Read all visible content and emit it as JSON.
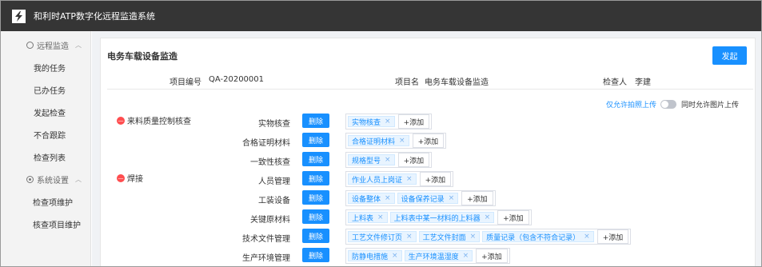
{
  "app": {
    "title": "和利时ATP数字化远程监造系统"
  },
  "sidebar": {
    "groups": [
      {
        "label": "远程监造",
        "items": [
          "我的任务",
          "已办任务",
          "发起检查",
          "不合跟踪",
          "检查列表"
        ]
      },
      {
        "label": "系统设置",
        "items": [
          "检查项维护",
          "核查项目维护"
        ]
      }
    ]
  },
  "page": {
    "title": "电务车载设备监造",
    "submit_label": "发起",
    "info": {
      "project_no_label": "项目编号",
      "project_no": "QA-20200001",
      "project_name_label": "项目名",
      "project_name": "电务车载设备监造",
      "inspector_label": "检查人",
      "inspector": "李建"
    },
    "toggle": {
      "left_label": "仅允许拍照上传",
      "right_label": "同时允许图片上传",
      "on": false
    },
    "categories": [
      {
        "name": "来料质量控制核查"
      },
      {
        "name": "焊接"
      }
    ],
    "rows": [
      {
        "label": "实物核查",
        "tags": [
          "实物核查"
        ]
      },
      {
        "label": "合格证明材料",
        "tags": [
          "合格证明材料"
        ]
      },
      {
        "label": "一致性核查",
        "tags": [
          "规格型号"
        ]
      },
      {
        "label": "人员管理",
        "tags": [
          "作业人员上岗证"
        ]
      },
      {
        "label": "工装设备",
        "tags": [
          "设备整体",
          "设备保养记录"
        ]
      },
      {
        "label": "关键原材料",
        "tags": [
          "上料表",
          "上料表中某一材料的上料器"
        ]
      },
      {
        "label": "技术文件管理",
        "tags": [
          "工艺文件修订页",
          "工艺文件封面",
          "质量记录（包含不符合记录）"
        ]
      },
      {
        "label": "生产环境管理",
        "tags": [
          "防静电措施",
          "生产环境温湿度"
        ]
      }
    ],
    "delete_label": "删除",
    "add_label": "+添加",
    "remove_glyph": "×"
  },
  "colors": {
    "accent": "#1890ff",
    "topbar": "#353535",
    "danger": "#ff4d4f"
  }
}
